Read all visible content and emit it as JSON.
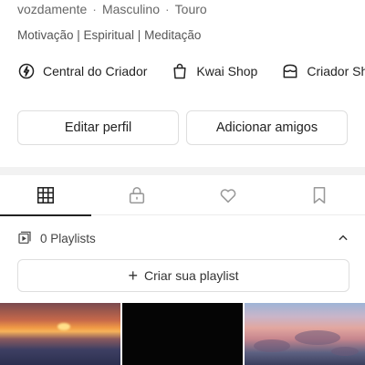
{
  "profile": {
    "meta": [
      "vozdamente",
      "Masculino",
      "Touro"
    ],
    "meta_separator": "·",
    "bio": "Motivação | Espiritual | Meditação"
  },
  "quick_links": [
    {
      "label": "Central do Criador",
      "icon": "lightning-circle-icon"
    },
    {
      "label": "Kwai Shop",
      "icon": "shopping-bag-icon"
    },
    {
      "label": "Criador Sho",
      "icon": "store-icon"
    }
  ],
  "actions": {
    "edit_profile": "Editar perfil",
    "add_friends": "Adicionar amigos"
  },
  "tabs": [
    {
      "name": "grid",
      "icon": "grid-icon",
      "active": true
    },
    {
      "name": "private",
      "icon": "lock-icon",
      "active": false
    },
    {
      "name": "likes",
      "icon": "heart-icon",
      "active": false
    },
    {
      "name": "saved",
      "icon": "bookmark-icon",
      "active": false
    }
  ],
  "playlists": {
    "count_label": "0 Playlists",
    "create_label": "Criar sua playlist",
    "create_icon": "+",
    "expanded": true
  },
  "colors": {
    "text": "#222222",
    "muted": "#666666",
    "border": "#dedede",
    "divider": "#f2f2f2"
  }
}
